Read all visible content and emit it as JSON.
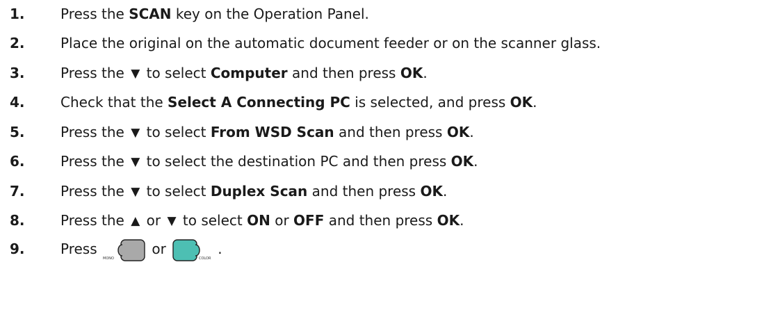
{
  "steps": [
    {
      "num": "1.",
      "parts": [
        {
          "t": "Press the "
        },
        {
          "b": "SCAN"
        },
        {
          "t": " key on the Operation Panel."
        }
      ]
    },
    {
      "num": "2.",
      "parts": [
        {
          "t": "Place the original on the automatic document feeder or on the scanner glass."
        }
      ]
    },
    {
      "num": "3.",
      "parts": [
        {
          "t": "Press the "
        },
        {
          "icon": "down-arrow-icon",
          "glyph": "▼"
        },
        {
          "t": " to select "
        },
        {
          "b": "Computer"
        },
        {
          "t": " and then press "
        },
        {
          "b": "OK"
        },
        {
          "t": "."
        }
      ]
    },
    {
      "num": "4.",
      "parts": [
        {
          "t": "Check that the "
        },
        {
          "b": "Select A Connecting PC"
        },
        {
          "t": " is selected, and press "
        },
        {
          "b": "OK"
        },
        {
          "t": "."
        }
      ]
    },
    {
      "num": "5.",
      "parts": [
        {
          "t": "Press the "
        },
        {
          "icon": "down-arrow-icon",
          "glyph": "▼"
        },
        {
          "t": " to select "
        },
        {
          "b": "From WSD Scan"
        },
        {
          "t": " and then press "
        },
        {
          "b": "OK"
        },
        {
          "t": "."
        }
      ]
    },
    {
      "num": "6.",
      "parts": [
        {
          "t": "Press the "
        },
        {
          "icon": "down-arrow-icon",
          "glyph": "▼"
        },
        {
          "t": " to select the destination PC and then press "
        },
        {
          "b": "OK"
        },
        {
          "t": "."
        }
      ]
    },
    {
      "num": "7.",
      "parts": [
        {
          "t": "Press the "
        },
        {
          "icon": "down-arrow-icon",
          "glyph": "▼"
        },
        {
          "t": " to select "
        },
        {
          "b": "Duplex Scan"
        },
        {
          "t": " and then press "
        },
        {
          "b": "OK"
        },
        {
          "t": "."
        }
      ]
    },
    {
      "num": "8.",
      "parts": [
        {
          "t": "Press the "
        },
        {
          "icon": "up-arrow-icon",
          "glyph": "▲"
        },
        {
          "t": " or "
        },
        {
          "icon": "down-arrow-icon",
          "glyph": "▼"
        },
        {
          "t": " to select "
        },
        {
          "b": "ON"
        },
        {
          "t": " or "
        },
        {
          "b": "OFF"
        },
        {
          "t": " and then press "
        },
        {
          "b": "OK"
        },
        {
          "t": "."
        }
      ]
    },
    {
      "num": "9.",
      "parts": [
        {
          "t": "Press "
        },
        {
          "key": "mono-key-icon",
          "label": "MONO"
        },
        {
          "t": " or "
        },
        {
          "key": "color-key-icon",
          "label": "COLOR"
        },
        {
          "t": "."
        }
      ]
    }
  ],
  "colors": {
    "text": "#1a1a1a",
    "mono_key": "#a9a9a9",
    "color_key": "#4dbfb3"
  }
}
